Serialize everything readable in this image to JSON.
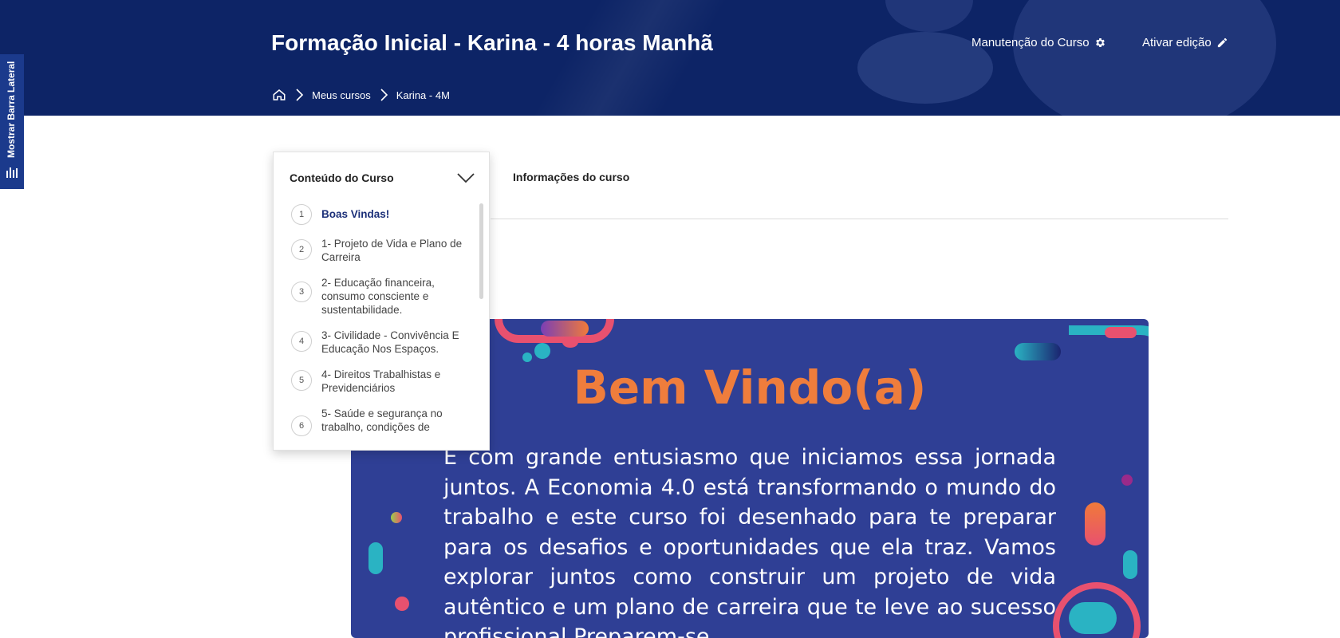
{
  "header": {
    "course_title": "Formação Inicial - Karina - 4 horas Manhã",
    "maintenance_label": "Manutenção do Curso",
    "edit_label": "Ativar edição",
    "breadcrumb": [
      "Meus cursos",
      "Karina - 4M"
    ],
    "icons": [
      "home-icon",
      "gear-icon",
      "pencil-icon",
      "chevron-right-icon"
    ]
  },
  "sidebar_toggle": {
    "label": "Mostrar Barra Lateral",
    "icon": "bar-chart-icon"
  },
  "course_content": {
    "title": "Conteúdo do Curso",
    "items": [
      {
        "num": "1",
        "label": "Boas Vindas!"
      },
      {
        "num": "2",
        "label": "1- Projeto de Vida e Plano de Carreira"
      },
      {
        "num": "3",
        "label": "2- Educação financeira, consumo consciente e sustentabilidade."
      },
      {
        "num": "4",
        "label": "3- Civilidade - Convivência E Educação Nos Espaços."
      },
      {
        "num": "5",
        "label": "4- Direitos Trabalhistas e Previdenciários"
      },
      {
        "num": "6",
        "label": "5- Saúde e segurança no trabalho, condições de"
      }
    ]
  },
  "tabs": {
    "info": "Informações do curso"
  },
  "banner": {
    "title": "Bem Vindo(a)",
    "text": "É com grande entusiasmo que iniciamos essa jornada juntos. A Economia 4.0 está transformando o mundo do trabalho e este curso foi desenhado para te preparar para os desafios e oportunidades que ela traz. Vamos explorar juntos como construir um projeto de vida autêntico e um plano de carreira que te leve ao sucesso profissional.Preparem-se"
  },
  "colors": {
    "header_bg": "#0d2466",
    "accent": "#1b2f78",
    "banner_bg": "#2f3f95",
    "banner_title": "#ef7d3c"
  }
}
